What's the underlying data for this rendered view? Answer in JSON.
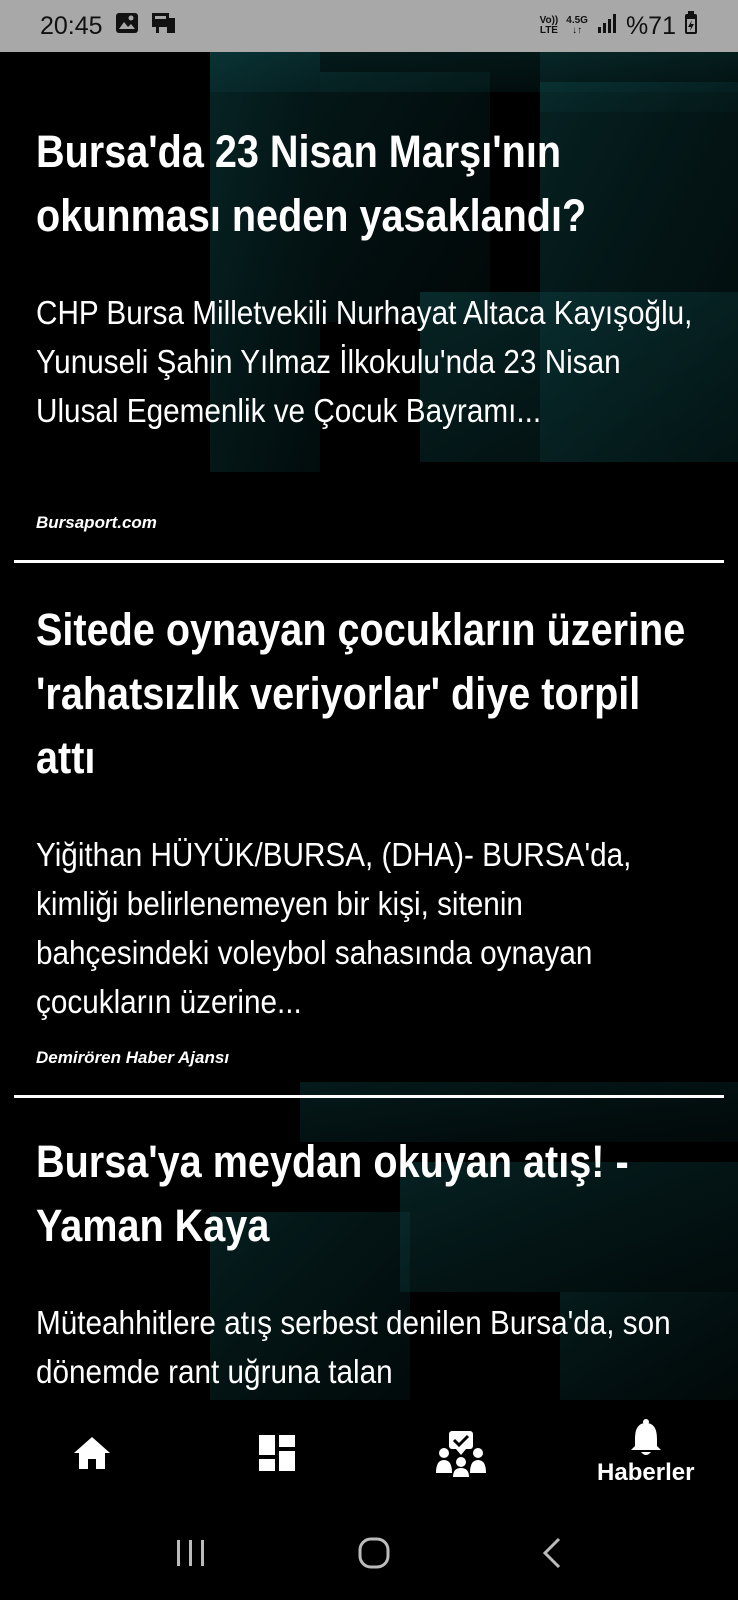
{
  "status_bar": {
    "time": "20:45",
    "volte_top": "Vo))",
    "volte_bottom": "LTE",
    "network_top": "4.5G",
    "network_bottom": "↓↑",
    "battery": "%71"
  },
  "articles": [
    {
      "headline": "Bursa'da 23 Nisan Marşı'nın okunması neden yasaklandı?",
      "summary": "CHP Bursa Milletvekili Nurhayat Altaca Kayışoğlu, Yunuseli Şahin Yılmaz İlkokulu'nda 23 Nisan Ulusal Egemenlik ve Çocuk Bayramı...",
      "source": "Bursaport.com"
    },
    {
      "headline": "Sitede oynayan çocukların üzerine 'rahatsızlık veriyorlar' diye torpil attı",
      "summary": "Yiğithan HÜYÜK/BURSA, (DHA)- BURSA'da, kimliği belirlenemeyen bir kişi, sitenin bahçesindeki voleybol sahasında oynayan çocukların üzerine...",
      "source": "Demirören Haber Ajansı"
    },
    {
      "headline": "Bursa'ya meydan okuyan atış! - Yaman Kaya",
      "summary": "Müteahhitlere atış serbest denilen Bursa'da, son dönemde rant uğruna talan"
    }
  ],
  "bottom_nav": {
    "items": [
      {
        "icon": "home-icon"
      },
      {
        "icon": "dashboard-icon"
      },
      {
        "icon": "community-icon"
      },
      {
        "icon": "bell-icon",
        "label": "Haberler"
      }
    ]
  },
  "system_nav": {
    "icons": [
      "recent-apps-icon",
      "home-button-icon",
      "back-icon"
    ]
  },
  "colors": {
    "status_bar_bg": "#a8a8a8",
    "background": "#000000",
    "accent_teal": "#0b3a3c"
  }
}
